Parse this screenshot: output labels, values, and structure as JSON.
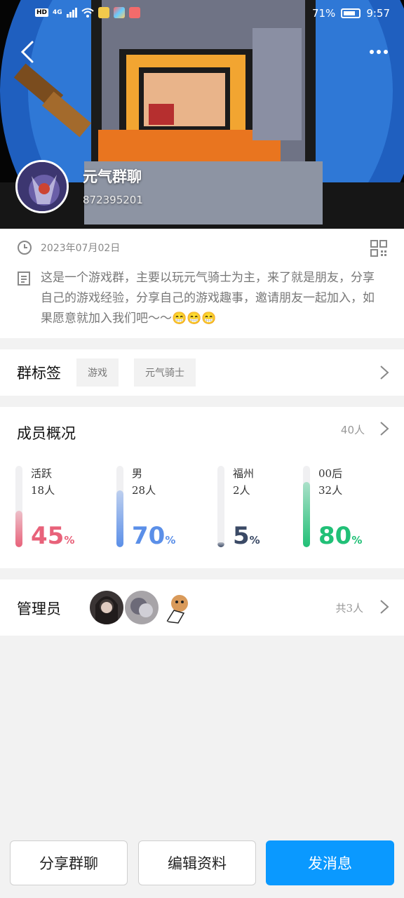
{
  "status_bar": {
    "network": "HD",
    "signal_type": "4G",
    "battery": "71%",
    "time": "9:57"
  },
  "header": {
    "back_icon": "chevron-left-icon",
    "more_icon": "more-dots-icon",
    "group_name": "元气群聊",
    "group_id": "872395201"
  },
  "info": {
    "date": "2023年07月02日",
    "description": "这是一个游戏群，主要以玩元气骑士为主，来了就是朋友，分享自己的游戏经验，分享自己的游戏趣事，邀请朋友一起加入，如果愿意就加入我们吧～～😁😁😁"
  },
  "tags": {
    "title": "群标签",
    "items": [
      "游戏",
      "元气骑士"
    ]
  },
  "members": {
    "title": "成员概况",
    "count": "40人",
    "stats": [
      {
        "label": "活跃",
        "count": "18人",
        "percent": 45,
        "percent_text": "45",
        "color": "#e8627a"
      },
      {
        "label": "男",
        "count": "28人",
        "percent": 70,
        "percent_text": "70",
        "color": "#5b8fe8"
      },
      {
        "label": "福州",
        "count": "2人",
        "percent": 5,
        "percent_text": "5",
        "color": "#3b4a66"
      },
      {
        "label": "00后",
        "count": "32人",
        "percent": 80,
        "percent_text": "80",
        "color": "#21c077"
      }
    ],
    "percent_unit": "%"
  },
  "admins": {
    "title": "管理员",
    "total": "共3人"
  },
  "bottom": {
    "share_label": "分享群聊",
    "edit_label": "编辑资料",
    "message_label": "发消息"
  },
  "colors": {
    "primary": "#0a99ff",
    "page_bg": "#f2f2f2"
  }
}
